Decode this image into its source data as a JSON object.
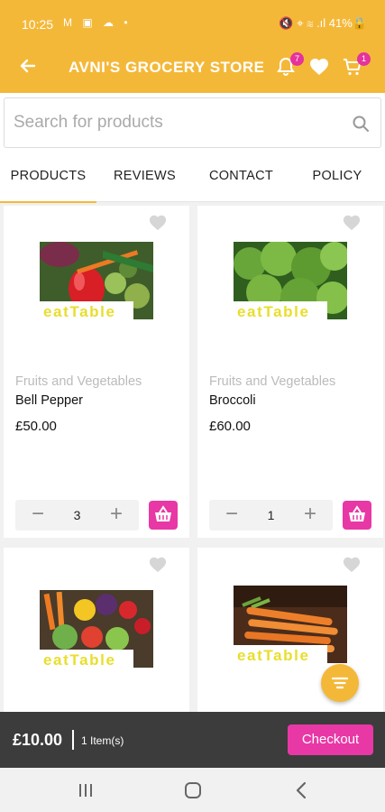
{
  "status_bar": {
    "time": "10:25",
    "left_glyphs": "M ▣ ☁ •",
    "right_text": "🔇 ⌖ ≋ .ıl 41%🔒"
  },
  "app_bar": {
    "title": "AVNI'S GROCERY STORE",
    "notification_count": "7",
    "cart_count": "1"
  },
  "search": {
    "placeholder": "Search for products"
  },
  "tabs": [
    {
      "label": "PRODUCTS",
      "active": true
    },
    {
      "label": "REVIEWS",
      "active": false
    },
    {
      "label": "CONTACT",
      "active": false
    },
    {
      "label": "POLICY",
      "active": false
    }
  ],
  "products": [
    {
      "category": "Fruits and Vegetables",
      "name": "Bell Pepper",
      "price": "£50.00",
      "qty": "3",
      "logo_text": "eatTable"
    },
    {
      "category": "Fruits and Vegetables",
      "name": "Broccoli",
      "price": "£60.00",
      "qty": "1",
      "logo_text": "eatTable"
    },
    {
      "logo_text": "eatTable"
    },
    {
      "logo_text": "eatTable"
    }
  ],
  "cart_bar": {
    "total": "£10.00",
    "items": "1 Item(s)",
    "checkout_label": "Checkout"
  },
  "colors": {
    "brand_yellow": "#f4b839",
    "accent_pink": "#e838a5",
    "dark_bar": "#3c3c3c"
  },
  "icons": [
    "back-arrow-icon",
    "bell-icon",
    "heart-icon",
    "cart-icon",
    "search-icon",
    "minus-icon",
    "plus-icon",
    "basket-icon",
    "filter-icon",
    "recents-icon",
    "home-icon",
    "back-icon"
  ]
}
